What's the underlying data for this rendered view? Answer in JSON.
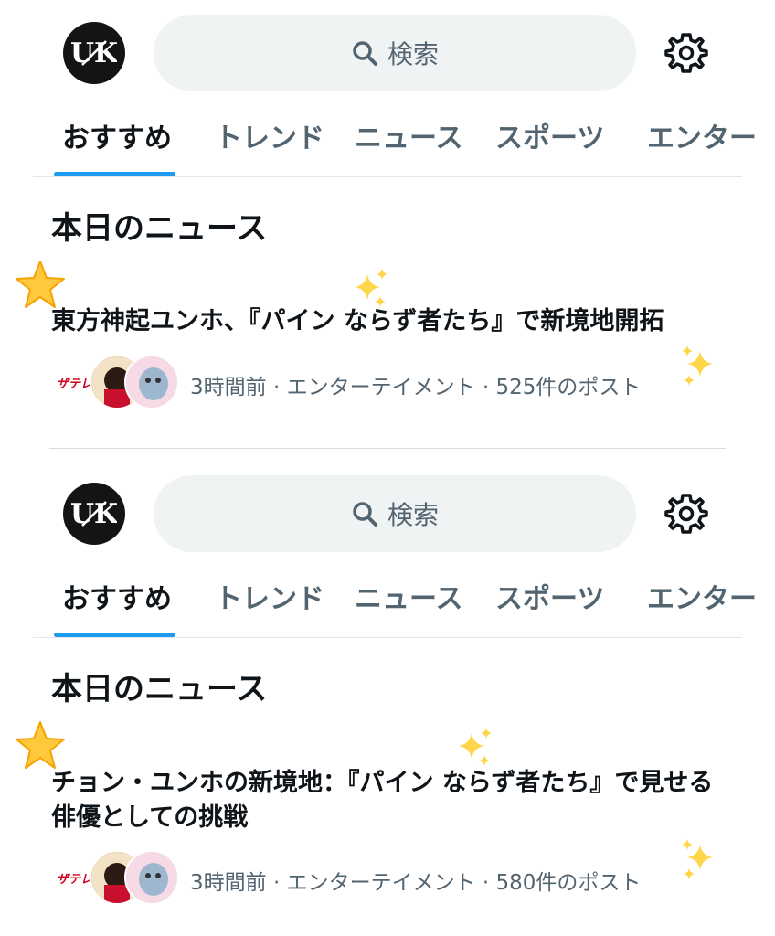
{
  "panels": [
    {
      "search_placeholder": "検索",
      "tabs": [
        "おすすめ",
        "トレンド",
        "ニュース",
        "スポーツ",
        "エンター"
      ],
      "section_title": "本日のニュース",
      "headline": "東方神起ユンホ、『パイン ならず者たち』で新境地開拓",
      "meta": "3時間前 · エンターテイメント · 525件のポスト"
    },
    {
      "search_placeholder": "検索",
      "tabs": [
        "おすすめ",
        "トレンド",
        "ニュース",
        "スポーツ",
        "エンター"
      ],
      "section_title": "本日のニュース",
      "headline": "チョン・ユンホの新境地：『パイン ならず者たち』で見せる俳優としての挑戦",
      "meta": "3時間前 · エンターテイメント · 580件のポスト"
    }
  ],
  "colors": {
    "accent": "#1d9bf0",
    "muted": "#536471",
    "text": "#0f1419"
  },
  "icons": [
    "profile-avatar-icon",
    "search-icon",
    "gear-icon",
    "star-emoji-icon",
    "sparkles-emoji-icon"
  ]
}
